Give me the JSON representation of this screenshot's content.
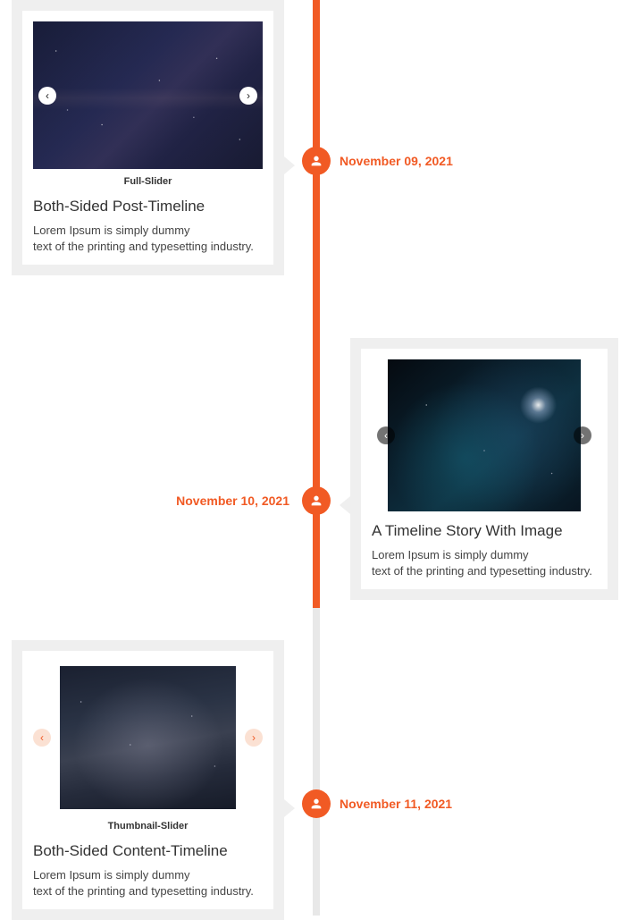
{
  "accent": "#f15a24",
  "items": [
    {
      "date": "November 09, 2021",
      "caption": "Full-Slider",
      "title": "Both-Sided Post-Timeline",
      "body_line1": "Lorem Ipsum is simply dummy",
      "body_line2": "text of the printing and typesetting industry."
    },
    {
      "date": "November 10, 2021",
      "title": "A Timeline Story With Image",
      "body_line1": "Lorem Ipsum is simply dummy",
      "body_line2": "text of the printing and typesetting industry."
    },
    {
      "date": "November 11, 2021",
      "caption": "Thumbnail-Slider",
      "title": "Both-Sided Content-Timeline",
      "body_line1": "Lorem Ipsum is simply dummy",
      "body_line2": "text of the printing and typesetting industry."
    }
  ]
}
